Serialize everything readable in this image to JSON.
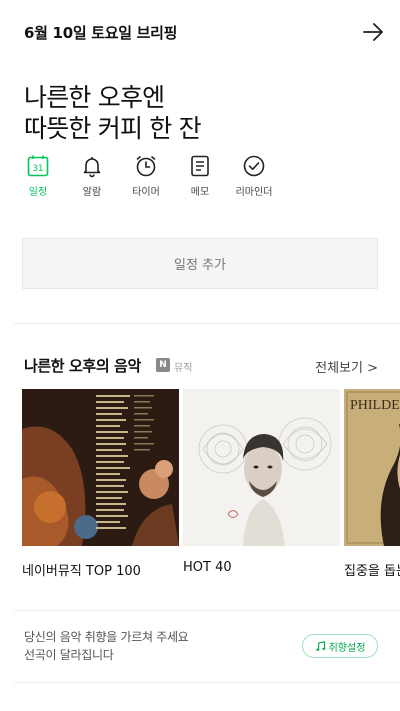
{
  "header": {
    "title": "6월 10일 토요일 브리핑"
  },
  "headline": {
    "line1": "나른한 오후엔",
    "line2": "따뜻한 커피 한 잔"
  },
  "shortcuts": [
    {
      "label": "일정",
      "icon": "calendar-icon",
      "badge": "31",
      "active": true
    },
    {
      "label": "알람",
      "icon": "bell-icon"
    },
    {
      "label": "타이머",
      "icon": "timer-icon"
    },
    {
      "label": "메모",
      "icon": "memo-icon"
    },
    {
      "label": "리마인더",
      "icon": "check-circle-icon"
    }
  ],
  "add_schedule_label": "일정 추가",
  "music": {
    "title": "나른한 오후의 음악",
    "badge": "N",
    "source": "뮤직",
    "view_all": "전체보기 >",
    "albums": [
      {
        "name": "네이버뮤직 TOP 100"
      },
      {
        "name": "HOT 40"
      },
      {
        "name": "집중을 돕는",
        "cover_text": "PHILDE"
      }
    ]
  },
  "taste": {
    "line1": "당신의 음악 취향을 가르쳐 주세요",
    "line2": "선곡이 달라집니다",
    "button": "취향설정"
  },
  "colors": {
    "accent": "#03c75a",
    "text": "#111111",
    "muted": "#777777"
  }
}
